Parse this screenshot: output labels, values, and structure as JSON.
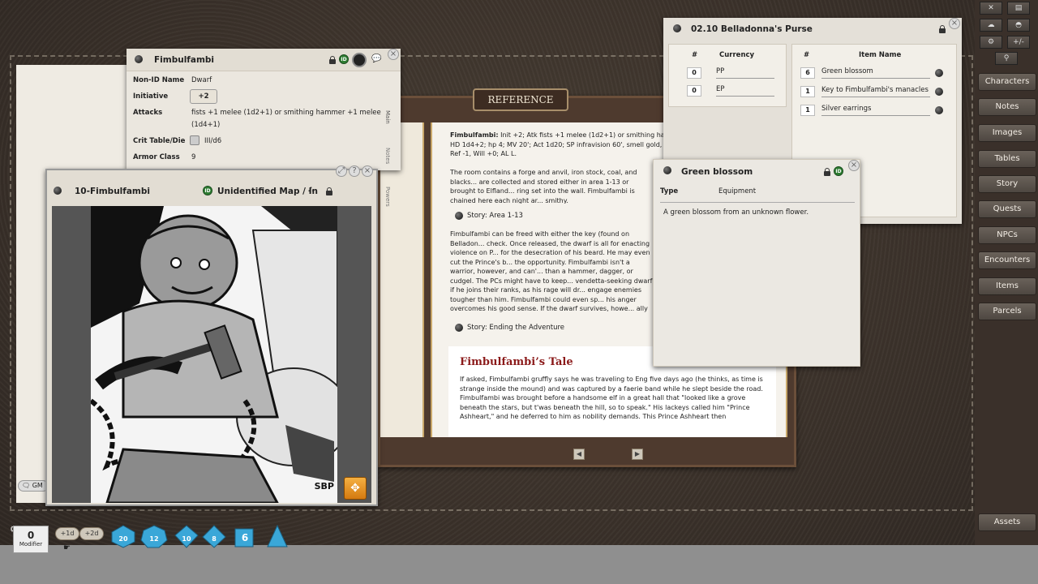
{
  "npc_window": {
    "title": "Fimbulfambi",
    "fields": {
      "nonid_label": "Non-ID Name",
      "nonid_value": "Dwarf",
      "initiative_label": "Initiative",
      "initiative_value": "+2",
      "attacks_label": "Attacks",
      "attacks_value": "fists +1 melee (1d2+1) or smithing hammer +1 melee (1d4+1)",
      "crit_label": "Crit Table/Die",
      "crit_value": "III/d6",
      "ac_label": "Armor Class",
      "ac_value": "9"
    },
    "side_tabs": [
      "Main",
      "Notes",
      "Powers"
    ]
  },
  "reference": {
    "tab": "REFERENCE",
    "stat_name": "Fimbulfambi:",
    "stat_text": "Init +2; Atk fists +1 melee (1d2+1) or smithing hammer +1 melee (1d4+1); AC 9; HD 1d4+2; hp 4; MV 20'; Act 1d20; SP infravision 60', smell gold, smithing knowledge; SV Fort +2, Ref -1, Will +0; AL L.",
    "para1": "The room contains a forge and anvil, iron stock, coal, and blacks... are collected and stored either in area 1-13 or brought to Elfland... ring set into the wall. Fimbulfambi is chained here each night ar... smithy.",
    "story1": "Story: Area 1-13",
    "para2": "Fimbulfambi can be freed with either the key (found on Belladon... check. Once released, the dwarf is all for enacting violence on P... for the desecration of his beard. He may even cut the Prince's b... the opportunity. Fimbulfambi isn't a warrior, however, and can'... than a hammer, dagger, or cudgel. The PCs might have to keep... vendetta-seeking dwarf if he joins their ranks, as his rage will dr... engage enemies tougher than him. Fimbulfambi could even sp... his anger overcomes his good sense. If the dwarf survives, howe... ally (see Ending the Adventure below).",
    "story2": "Story: Ending the Adventure",
    "tale_title": "Fimbulfambi’s Tale",
    "tale_text": "If asked, Fimbulfambi gruffly says he was traveling to Eng five days ago (he thinks, as time is strange inside the mound) and was captured by a faerie band while he slept beside the road. Fimbulfambi was brought before a handsome elf in a great hall that \"looked like a grove beneath the stars, but t'was beneath the hill, so to speak.\" His lackeys called him \"Prince Ashheart,\" and he deferred to him as nobility demands. This Prince Ashheart then"
  },
  "map_window": {
    "title": "10-Fimbulfambi",
    "subtitle": "Unidentified Map / In",
    "image_credit": "SBP"
  },
  "purse": {
    "title": "02.10 Belladonna's Purse",
    "currency_header_num": "#",
    "currency_header": "Currency",
    "currency_rows": [
      {
        "num": "0",
        "name": "PP"
      },
      {
        "num": "0",
        "name": "EP"
      }
    ],
    "items_header_num": "#",
    "items_header": "Item Name",
    "item_rows": [
      {
        "num": "6",
        "name": "Green blossom"
      },
      {
        "num": "1",
        "name": "Key to Fimbulfambi's manacles"
      },
      {
        "num": "1",
        "name": "Silver earrings"
      }
    ]
  },
  "green_blossom": {
    "title": "Green blossom",
    "type_label": "Type",
    "type_value": "Equipment",
    "description": "A green blossom from an unknown flower."
  },
  "sidebar": {
    "buttons": [
      "Characters",
      "Notes",
      "Images",
      "Tables",
      "Story",
      "Quests",
      "NPCs",
      "Encounters",
      "Items",
      "Parcels"
    ],
    "assets": "Assets",
    "tool_minus_plus": "+/-"
  },
  "chat": {
    "gm_label": "GM"
  },
  "bottom": {
    "modifier_value": "0",
    "modifier_label": "Modifier",
    "chip1": "+1d",
    "chip2": "+2d",
    "dice": [
      "20",
      "12",
      "10",
      "8",
      "6",
      ""
    ]
  },
  "colors": {
    "accent_red": "#8b1a1a",
    "id_green": "#2e7d32",
    "dice_blue": "#3aa7d8"
  }
}
